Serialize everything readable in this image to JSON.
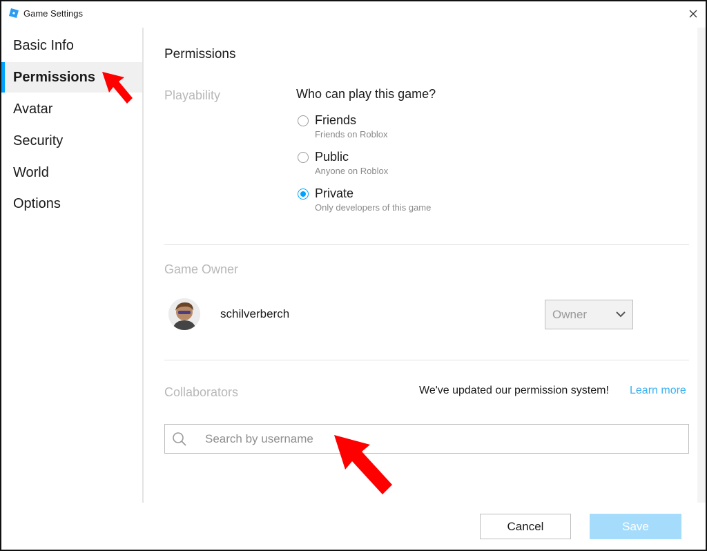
{
  "window": {
    "title": "Game Settings"
  },
  "sidebar": {
    "items": [
      {
        "label": "Basic Info",
        "active": false
      },
      {
        "label": "Permissions",
        "active": true
      },
      {
        "label": "Avatar",
        "active": false
      },
      {
        "label": "Security",
        "active": false
      },
      {
        "label": "World",
        "active": false
      },
      {
        "label": "Options",
        "active": false
      }
    ]
  },
  "main": {
    "title": "Permissions",
    "playability": {
      "label": "Playability",
      "question": "Who can play this game?",
      "options": [
        {
          "label": "Friends",
          "description": "Friends on Roblox",
          "selected": false
        },
        {
          "label": "Public",
          "description": "Anyone on Roblox",
          "selected": false
        },
        {
          "label": "Private",
          "description": "Only developers of this game",
          "selected": true
        }
      ]
    },
    "game_owner": {
      "label": "Game Owner",
      "username": "schilverberch",
      "role": "Owner"
    },
    "collaborators": {
      "label": "Collaborators",
      "notice": "We've updated our permission system!",
      "learn_more": "Learn more",
      "search_placeholder": "Search by username"
    }
  },
  "footer": {
    "cancel_label": "Cancel",
    "save_label": "Save"
  },
  "colors": {
    "accent": "#00a2ff",
    "link": "#3ab0f0",
    "save_disabled": "#a6dcfb",
    "annotation": "#ff0000"
  },
  "icons": [
    "roblox-logo-icon",
    "close-icon",
    "chevron-down-icon",
    "search-icon",
    "annotation-arrow-icon"
  ]
}
